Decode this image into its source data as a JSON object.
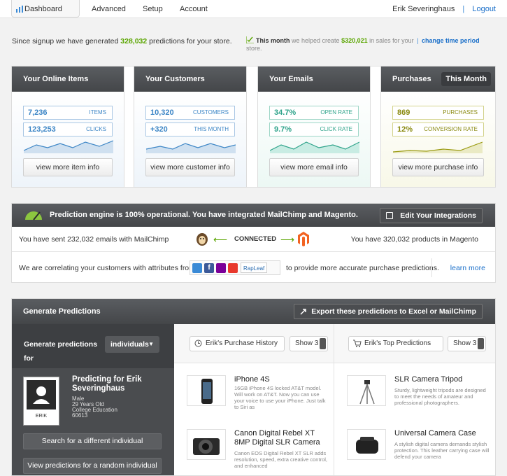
{
  "nav": {
    "tabs": [
      {
        "label": "Dashboard",
        "active": true,
        "icon": "bar-chart-icon"
      },
      {
        "label": "Advanced"
      },
      {
        "label": "Setup"
      },
      {
        "label": "Account"
      }
    ],
    "user_name": "Erik Severinghaus",
    "separator": "|",
    "logout": "Logout"
  },
  "summary": {
    "prefix": "Since signup we have generated",
    "count": "328,032",
    "suffix": "predictions for your store."
  },
  "month_summary": {
    "this_month": "This month",
    "mid1": "we helped create",
    "amount": "$320,021",
    "mid2": "in sales for your",
    "pipe": "|",
    "link": "change time period",
    "tail": "store."
  },
  "panels": [
    {
      "title": "Your Online Items",
      "stat1": {
        "value": "7,236",
        "unit": "ITEMS"
      },
      "stat2": {
        "value": "123,253",
        "unit": "CLICKS"
      },
      "button": "view more item info",
      "color": "#3d86c6",
      "fill": "#cfe0f0"
    },
    {
      "title": "Your Customers",
      "stat1": {
        "value": "10,320",
        "unit": "CUSTOMERS"
      },
      "stat2": {
        "value": "+320",
        "unit": "THIS MONTH"
      },
      "button": "view more customer info",
      "color": "#3d86c6",
      "fill": "#cfe0f0"
    },
    {
      "title": "Your Emails",
      "stat1": {
        "value": "34.7%",
        "unit": "OPEN RATE"
      },
      "stat2": {
        "value": "9.7%",
        "unit": "CLICK RATE"
      },
      "button": "view more email info",
      "color": "#2ea38a",
      "fill": "#c8ece3"
    },
    {
      "title": "Purchases",
      "pill": "This Month",
      "stat1": {
        "value": "869",
        "unit": "PURCHASES"
      },
      "stat2": {
        "value": "12%",
        "unit": "CONVERSION RATE"
      },
      "button": "view more purchase info",
      "color": "#9a9a10",
      "fill": "#eaeac4"
    }
  ],
  "engine": {
    "title": "Prediction engine is 100% operational. You have integrated MailChimp and Magento.",
    "edit": "Edit Your Integrations",
    "sent": "You have sent 232,032 emails with MailChimp",
    "connected": "CONNECTED",
    "products": "You have 320,032 products in Magento",
    "correlating": "We are correlating your customers with attributes from",
    "correlating_tail": "to provide more accurate purchase predictions.",
    "learn_more": "learn more",
    "rapleaf": "RapLeaf"
  },
  "predictions": {
    "title": "Generate Predictions",
    "export": "Export these predictions to Excel or MailChimp",
    "gen_label_1": "Generate predictions",
    "gen_label_2": "for",
    "gen_mode": "individuals",
    "predicting_for": "Predicting for Erik Severinghaus",
    "person": {
      "gender": "Male",
      "age": "29 Years Old",
      "edu": "College Education",
      "zip": "60613",
      "name": "ERIK"
    },
    "search_btn": "Search for a different individual",
    "random_btn": "View predictions for a random individual",
    "history_label": "Erik's Purchase History",
    "top_label": "Erik's Top Predictions",
    "show_label": "Show 3",
    "history": [
      {
        "title": "iPhone 4S",
        "desc": "16GB iPhone 4S locked AT&T model. Will work on AT&T. Now you can use your voice to use your iPhone. Just talk to Siri as",
        "icon": "phone-icon"
      },
      {
        "title": "Canon Digital Rebel XT 8MP Digital SLR Camera",
        "desc": "Canon EOS Digital Rebel XT SLR adds resolution, speed, extra creative control, and enhanced",
        "icon": "camera-icon"
      }
    ],
    "top": [
      {
        "title": "SLR Camera Tripod",
        "desc": "Sturdy, lightweight tripods are designed to meet the needs of amateur and professional photographers.",
        "icon": "tripod-icon"
      },
      {
        "title": "Universal Camera Case",
        "desc": "A stylish digital camera demands stylish protection. This leather carrying case will defend your camera",
        "icon": "camera-case-icon"
      }
    ]
  }
}
